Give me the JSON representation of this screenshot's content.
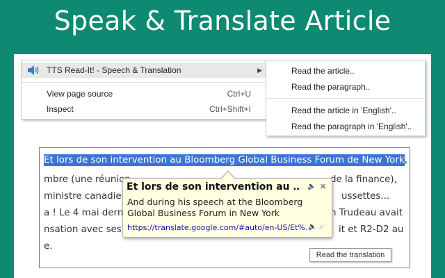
{
  "banner": {
    "title": "Speak & Translate Article"
  },
  "context_menu": {
    "items": [
      {
        "label": "TTS Read-It! - Speech & Translation",
        "shortcut": "",
        "has_submenu": true,
        "icon": "speaker-icon"
      },
      {
        "label": "View page source",
        "shortcut": "Ctrl+U"
      },
      {
        "label": "Inspect",
        "shortcut": "Ctrl+Shift+I"
      }
    ]
  },
  "submenu": {
    "items": [
      "Read the article..",
      "Read the paragraph..",
      "Read the article in 'English'..",
      "Read the paragraph in 'English'.."
    ]
  },
  "article": {
    "selected_text": "Et lors de son intervention au Bloomberg Global Business Forum de New York",
    "selected_suffix": ",",
    "lines": [
      "mbre (une réunion",
      "ministre canadien",
      "a ! Le 4 mai dernie",
      "nsation avec ses",
      "e."
    ],
    "lines_right": [
      "de la finance),",
      "ussettes...",
      "n Trudeau avait",
      "it et R2-D2 au",
      ""
    ]
  },
  "popup": {
    "title": "Et lors de son intervention au …",
    "translation": "And during his speech at the Bloomberg Global Business Forum in New York",
    "link": "https://translate.google.com/#auto/en-US/Et%...",
    "speaker_icon": "🔈",
    "close_icon": "✖",
    "search_icon": "⌕"
  },
  "tooltip": {
    "label": "Read the translation"
  },
  "colors": {
    "background": "#0e8a73",
    "selection": "#3875d7",
    "popup": "#ffffe1"
  }
}
